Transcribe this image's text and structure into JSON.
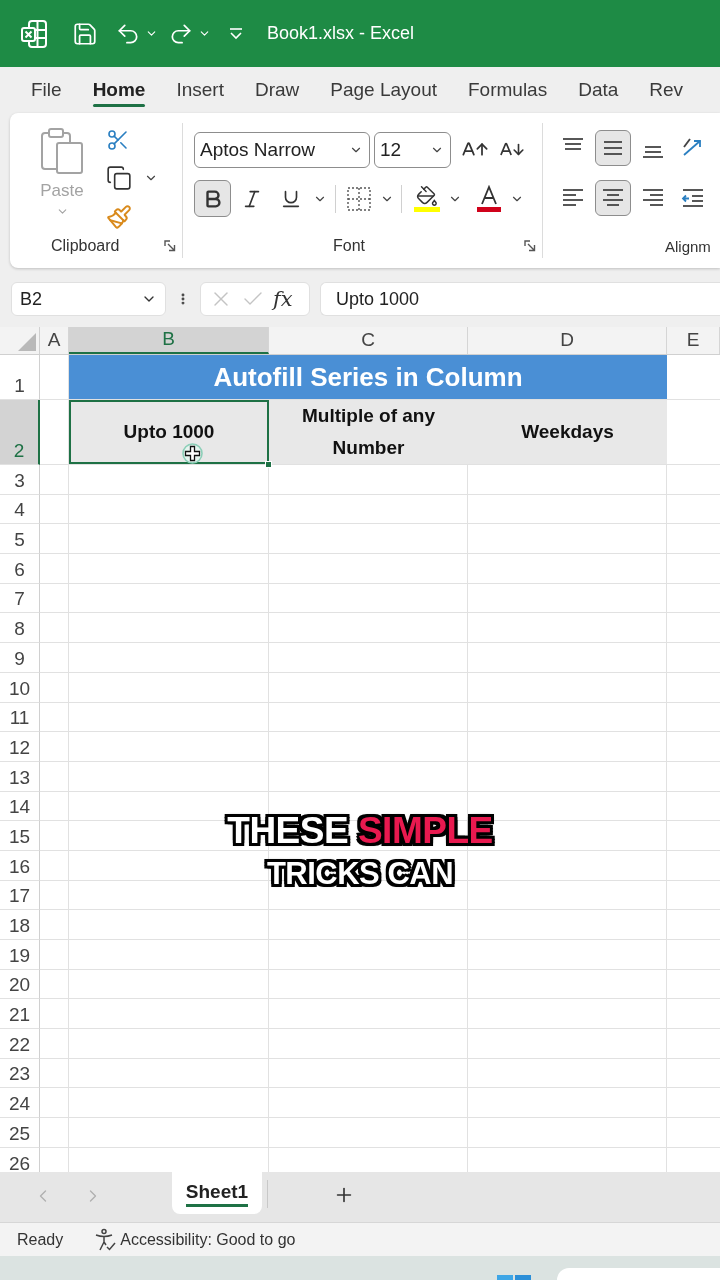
{
  "title_bar": {
    "title": "Book1.xlsx - Excel"
  },
  "ribbon_tabs": [
    {
      "label": "File",
      "selected": false
    },
    {
      "label": "Home",
      "selected": true
    },
    {
      "label": "Insert",
      "selected": false
    },
    {
      "label": "Draw",
      "selected": false
    },
    {
      "label": "Page Layout",
      "selected": false
    },
    {
      "label": "Formulas",
      "selected": false
    },
    {
      "label": "Data",
      "selected": false
    },
    {
      "label": "Rev",
      "selected": false
    }
  ],
  "ribbon": {
    "clipboard": {
      "paste_label": "Paste",
      "paste_disabled": true,
      "group_label": "Clipboard"
    },
    "font": {
      "font_name": "Aptos Narrow",
      "font_size": "12",
      "styles": [
        {
          "kind": "bold",
          "selected": true
        },
        {
          "kind": "italic",
          "selected": false
        },
        {
          "kind": "underline",
          "selected": false
        }
      ],
      "group_label": "Font"
    },
    "alignment": {
      "buttons": [
        {
          "kind": "top",
          "selected": false
        },
        {
          "kind": "middle",
          "selected": true
        },
        {
          "kind": "bottom",
          "selected": false
        },
        {
          "kind": "orientation",
          "selected": false
        },
        {
          "kind": "left",
          "selected": false
        },
        {
          "kind": "center",
          "selected": true
        },
        {
          "kind": "right",
          "selected": false
        },
        {
          "kind": "decrease_indent",
          "selected": false
        }
      ],
      "group_label": "Alignm"
    }
  },
  "formula_bar": {
    "name_box": "B2",
    "function_label": "fx",
    "formula": "Upto 1000"
  },
  "sheet": {
    "columns": [
      {
        "label": "A",
        "selected": false
      },
      {
        "label": "B",
        "selected": true
      },
      {
        "label": "C",
        "selected": false
      },
      {
        "label": "D",
        "selected": false
      },
      {
        "label": "E",
        "selected": false
      }
    ],
    "rows": [
      {
        "label": "1",
        "selected": false
      },
      {
        "label": "2",
        "selected": true
      },
      {
        "label": "3",
        "selected": false
      },
      {
        "label": "4",
        "selected": false
      },
      {
        "label": "5",
        "selected": false
      },
      {
        "label": "6",
        "selected": false
      },
      {
        "label": "7",
        "selected": false
      },
      {
        "label": "8",
        "selected": false
      },
      {
        "label": "9",
        "selected": false
      },
      {
        "label": "10",
        "selected": false
      },
      {
        "label": "11",
        "selected": false
      },
      {
        "label": "12",
        "selected": false
      },
      {
        "label": "13",
        "selected": false
      },
      {
        "label": "14",
        "selected": false
      },
      {
        "label": "15",
        "selected": false
      },
      {
        "label": "16",
        "selected": false
      },
      {
        "label": "17",
        "selected": false
      },
      {
        "label": "18",
        "selected": false
      },
      {
        "label": "19",
        "selected": false
      },
      {
        "label": "20",
        "selected": false
      },
      {
        "label": "21",
        "selected": false
      },
      {
        "label": "22",
        "selected": false
      },
      {
        "label": "23",
        "selected": false
      },
      {
        "label": "24",
        "selected": false
      },
      {
        "label": "25",
        "selected": false
      },
      {
        "label": "26",
        "selected": false
      }
    ],
    "title_cell": "Autofill Series in Column",
    "header_cells": [
      {
        "text": "Upto 1000",
        "selected": true
      },
      {
        "text": "Multiple of any Number",
        "selected": false
      },
      {
        "text": "Weekdays",
        "selected": false
      }
    ]
  },
  "caption": {
    "lines": [
      {
        "segments": [
          {
            "text": "THESE",
            "highlight": false
          },
          {
            "text": "SIMPLE",
            "highlight": true
          }
        ]
      },
      {
        "segments": [
          {
            "text": "TRICKS CAN",
            "highlight": false
          }
        ]
      }
    ]
  },
  "sheet_tabs": [
    {
      "label": "Sheet1",
      "selected": true
    }
  ],
  "status_bar": {
    "mode": "Ready",
    "accessibility": "Accessibility: Good to go"
  }
}
